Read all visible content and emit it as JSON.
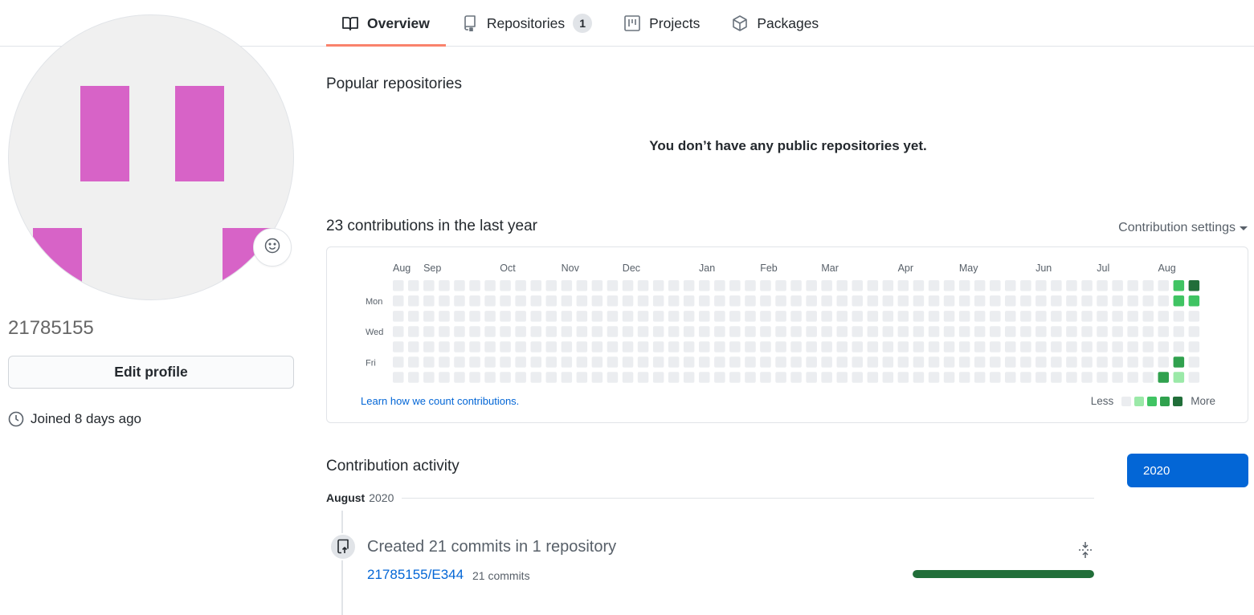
{
  "tabs": [
    {
      "label": "Overview",
      "icon": "book-icon",
      "selected": true
    },
    {
      "label": "Repositories",
      "icon": "repo-icon",
      "counter": "1"
    },
    {
      "label": "Projects",
      "icon": "project-icon"
    },
    {
      "label": "Packages",
      "icon": "package-icon"
    }
  ],
  "profile": {
    "username": "21785155",
    "edit_label": "Edit profile",
    "joined": "Joined 8 days ago",
    "avatar_color": "#d763c7"
  },
  "popular": {
    "title": "Popular repositories",
    "empty_message": "You don’t have any public repositories yet."
  },
  "contributions": {
    "title": "23 contributions in the last year",
    "settings_label": "Contribution settings",
    "months": [
      "Aug",
      "Sep",
      "Oct",
      "Nov",
      "Dec",
      "Jan",
      "Feb",
      "Mar",
      "Apr",
      "May",
      "Jun",
      "Jul",
      "Aug"
    ],
    "days": [
      "Mon",
      "Wed",
      "Fri"
    ],
    "learn_link": "Learn how we count contributions.",
    "legend_less": "Less",
    "legend_more": "More",
    "colors": [
      "#ebedf0",
      "#9be9a8",
      "#40c463",
      "#30a14e",
      "#216e39"
    ],
    "weeks": 53,
    "last_week_days": 7,
    "levels": [
      {
        "week": 51,
        "day": 0,
        "level": 2
      },
      {
        "week": 52,
        "day": 0,
        "level": 4
      },
      {
        "week": 51,
        "day": 1,
        "level": 2
      },
      {
        "week": 52,
        "day": 1,
        "level": 2
      },
      {
        "week": 51,
        "day": 5,
        "level": 3
      },
      {
        "week": 50,
        "day": 6,
        "level": 3
      },
      {
        "week": 51,
        "day": 6,
        "level": 1
      }
    ]
  },
  "activity": {
    "title": "Contribution activity",
    "year_button": "2020",
    "month": "August",
    "year": "2020",
    "commit_title": "Created 21 commits in 1 repository",
    "repo": "21785155/E344",
    "repo_commits": "21 commits",
    "progress": 1.0
  }
}
